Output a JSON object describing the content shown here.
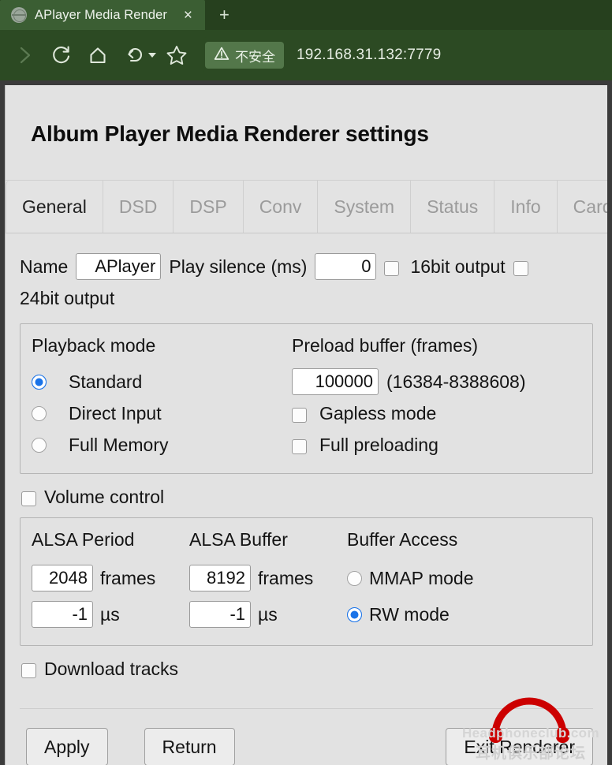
{
  "browser": {
    "tab": {
      "title": "APlayer Media Render",
      "favicon": "globe-icon",
      "close_label": "×"
    },
    "new_tab_label": "+",
    "toolbar": {
      "forward_icon": "chevron-right-icon",
      "reload_icon": "reload-icon",
      "home_icon": "home-icon",
      "history_icon": "undo-arrow-icon",
      "bookmark_icon": "star-icon"
    },
    "omnibox": {
      "security_icon": "warning-triangle-icon",
      "security_label": "不安全",
      "url": "192.168.31.132:7779",
      "placeholder": "192.168.31.132:7779"
    },
    "colors": {
      "chrome_dark_green": "#26401e",
      "toolbar_green": "#2c4a23",
      "active_tab_green": "#3b5e33",
      "badge_green": "#53774a"
    }
  },
  "page": {
    "title": "Album Player Media Renderer settings",
    "tabs": [
      {
        "label": "General",
        "active": true
      },
      {
        "label": "DSD",
        "active": false
      },
      {
        "label": "DSP",
        "active": false
      },
      {
        "label": "Conv",
        "active": false
      },
      {
        "label": "System",
        "active": false
      },
      {
        "label": "Status",
        "active": false
      },
      {
        "label": "Info",
        "active": false
      },
      {
        "label": "Card",
        "active": false
      }
    ],
    "general": {
      "name_label": "Name",
      "name_value": "APlayer",
      "play_silence_label": "Play silence (ms)",
      "play_silence_value": "0",
      "bit16_label": "16bit output",
      "bit16_checked": false,
      "bit24_label": "24bit output",
      "bit24_checked": false,
      "playback": {
        "heading": "Playback mode",
        "selected": "Standard",
        "options": [
          {
            "label": "Standard",
            "selected": true
          },
          {
            "label": "Direct Input",
            "selected": false
          },
          {
            "label": "Full Memory",
            "selected": false
          }
        ]
      },
      "preload": {
        "heading": "Preload buffer (frames)",
        "value": "100000",
        "range": "(16384-8388608)",
        "gapless_label": "Gapless mode",
        "gapless_checked": false,
        "full_preloading_label": "Full preloading",
        "full_preloading_checked": false
      },
      "volume_control_label": "Volume control",
      "volume_control_checked": false,
      "alsa": {
        "period_heading": "ALSA Period",
        "period_frames": "2048",
        "period_frames_unit": "frames",
        "period_us": "-1",
        "period_us_unit": "µs",
        "buffer_heading": "ALSA Buffer",
        "buffer_frames": "8192",
        "buffer_frames_unit": "frames",
        "buffer_us": "-1",
        "buffer_us_unit": "µs",
        "access_heading": "Buffer Access",
        "access_options": [
          {
            "label": "MMAP mode",
            "selected": false
          },
          {
            "label": "RW mode",
            "selected": true
          }
        ]
      },
      "download_tracks_label": "Download tracks",
      "download_tracks_checked": false
    },
    "buttons": {
      "apply": "Apply",
      "return": "Return",
      "exit": "Exit Renderer"
    },
    "accent": "#1a73e8"
  },
  "watermark": {
    "icon": "headphones-icon",
    "english": "Headphoneclub.com",
    "chinese": "耳机俱乐部论坛",
    "color": "#cc0000"
  }
}
